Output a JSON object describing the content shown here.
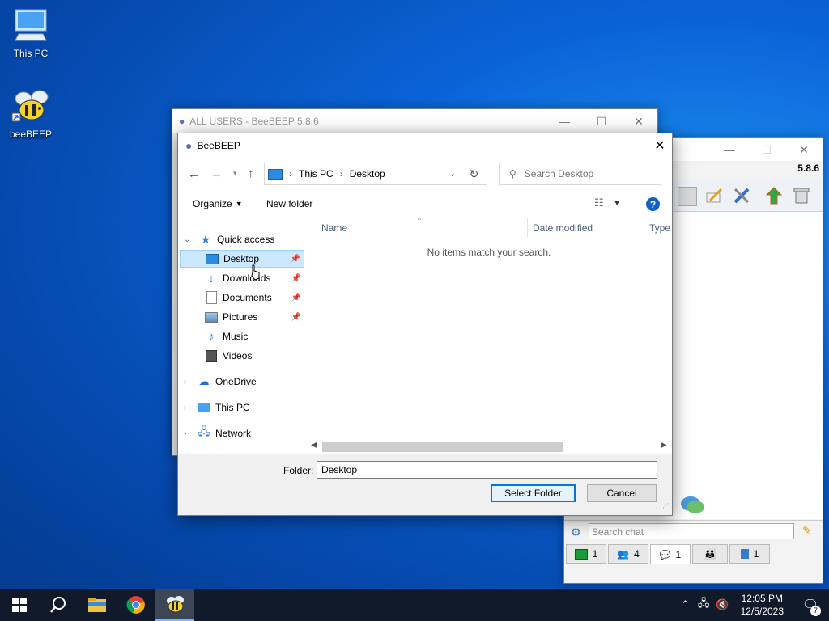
{
  "desktop": {
    "icons": [
      {
        "label": "This PC"
      },
      {
        "label": "beeBEEP"
      }
    ]
  },
  "main_window": {
    "title": "ALL USERS - BeeBEEP 5.8.6"
  },
  "chat_window": {
    "version": "5.8.6",
    "search_placeholder": "Search chat",
    "tabs": [
      {
        "icon": "computer-icon",
        "count": "1"
      },
      {
        "icon": "users-icon",
        "count": "4"
      },
      {
        "icon": "chat-icon",
        "count": "1"
      },
      {
        "icon": "groups-icon",
        "count": ""
      },
      {
        "icon": "share-icon",
        "count": "1"
      }
    ]
  },
  "dialog": {
    "title": "BeeBEEP",
    "breadcrumb": [
      "This PC",
      "Desktop"
    ],
    "search_placeholder": "Search Desktop",
    "toolbar": {
      "organize": "Organize",
      "new_folder": "New folder"
    },
    "columns": {
      "name": "Name",
      "date_modified": "Date modified",
      "type": "Type"
    },
    "empty_message": "No items match your search.",
    "nav": {
      "quick_access": "Quick access",
      "items": [
        "Desktop",
        "Downloads",
        "Documents",
        "Pictures",
        "Music",
        "Videos"
      ],
      "onedrive": "OneDrive",
      "this_pc": "This PC",
      "network": "Network"
    },
    "folder_label": "Folder:",
    "folder_value": "Desktop",
    "select_button": "Select Folder",
    "cancel_button": "Cancel"
  },
  "taskbar": {
    "time": "12:05 PM",
    "date": "12/5/2023",
    "notification_count": "7"
  }
}
